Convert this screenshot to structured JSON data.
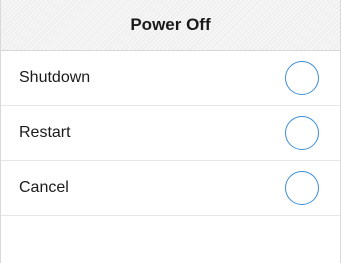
{
  "dialog": {
    "title": "Power Off",
    "options": [
      {
        "label": "Shutdown",
        "selected": false
      },
      {
        "label": "Restart",
        "selected": false
      },
      {
        "label": "Cancel",
        "selected": false
      }
    ],
    "accent_color": "#3e8ed8"
  }
}
